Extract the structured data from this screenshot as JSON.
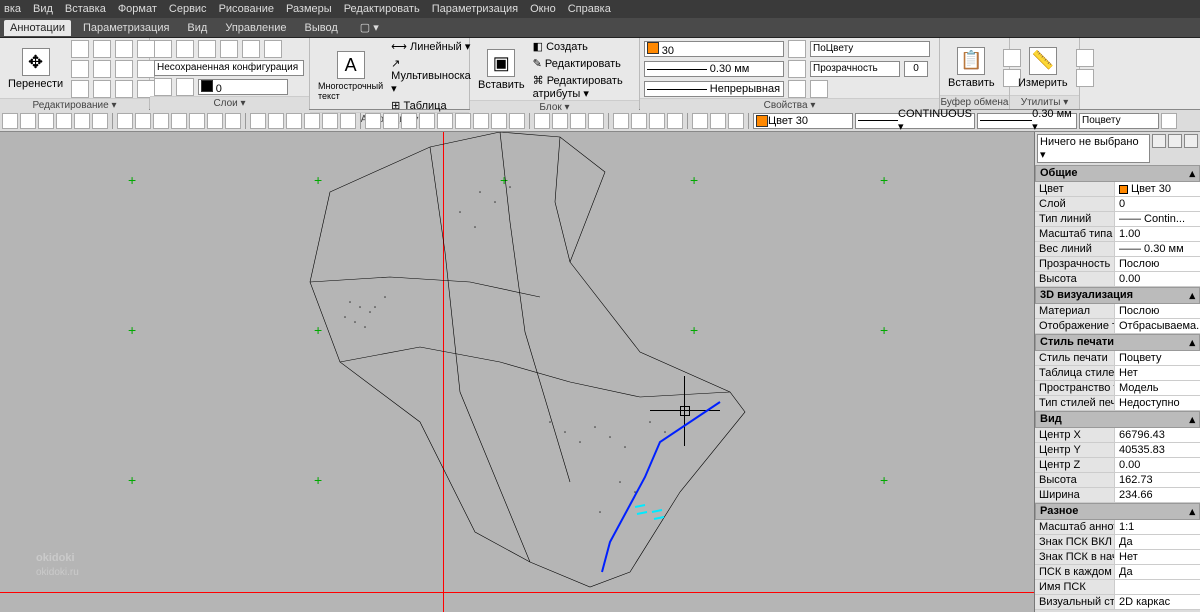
{
  "menu": [
    "вка",
    "Вид",
    "Вставка",
    "Формат",
    "Сервис",
    "Рисование",
    "Размеры",
    "Редактировать",
    "Параметризация",
    "Окно",
    "Справка"
  ],
  "tabs": {
    "items": [
      "Аннотации",
      "Параметризация",
      "Вид",
      "Управление",
      "Вывод"
    ],
    "active": 0
  },
  "ribbon": {
    "edit": {
      "label": "Редактирование ▾",
      "move": "Перенести",
      "config": "Несохраненная конфигурация сл",
      "configDrop": "▾"
    },
    "layers": {
      "label": "Слои ▾",
      "swatch": "#000",
      "current": "0"
    },
    "annotation": {
      "label": "Аннотации ▾",
      "mtext": "Многострочный текст",
      "linear": "Линейный ▾",
      "mleader": "Мультивыноска ▾",
      "table": "Таблица"
    },
    "block": {
      "label": "Блок ▾",
      "insert": "Вставить",
      "create": "Создать",
      "edit": "Редактировать",
      "attrs": "Редактировать атрибуты ▾"
    },
    "properties": {
      "label": "Свойства ▾",
      "colorSwatch": "#ff8800",
      "colorName": "30",
      "lineweight": "0.30 мм",
      "linetype": "Непрерывная",
      "bycolor": "ПоЦвету",
      "transparency": "Прозрачность",
      "transVal": "0"
    },
    "clipboard": {
      "label": "Буфер обмена",
      "paste": "Вставить"
    },
    "utils": {
      "label": "Утилиты ▾",
      "measure": "Измерить"
    }
  },
  "toolstrip": {
    "colorSwatch": "#ff8800",
    "colorName": "Цвет 30",
    "linetype": "CONTINUOUS ▾",
    "lineweight": "0.30 мм ▾",
    "plotstyle": "Поцвету"
  },
  "props": {
    "selection": "Ничего не выбрано",
    "sections": [
      {
        "title": "Общие",
        "rows": [
          {
            "k": "Цвет",
            "v": "Цвет 30",
            "sw": true
          },
          {
            "k": "Слой",
            "v": "0"
          },
          {
            "k": "Тип линий",
            "v": "—— Contin..."
          },
          {
            "k": "Масштаб типа л...",
            "v": "1.00"
          },
          {
            "k": "Вес линий",
            "v": "—— 0.30 мм"
          },
          {
            "k": "Прозрачность",
            "v": "Послою"
          },
          {
            "k": "Высота",
            "v": "0.00"
          }
        ]
      },
      {
        "title": "3D визуализация",
        "rows": [
          {
            "k": "Материал",
            "v": "Послою"
          },
          {
            "k": "Отображение те...",
            "v": "Отбрасываема..."
          }
        ]
      },
      {
        "title": "Стиль печати",
        "rows": [
          {
            "k": "Стиль печати",
            "v": "Поцвету"
          },
          {
            "k": "Таблица стилей ...",
            "v": "Нет"
          },
          {
            "k": "Пространство та...",
            "v": "Модель"
          },
          {
            "k": "Тип стилей печати",
            "v": "Недоступно"
          }
        ]
      },
      {
        "title": "Вид",
        "rows": [
          {
            "k": "Центр X",
            "v": "66796.43"
          },
          {
            "k": "Центр Y",
            "v": "40535.83"
          },
          {
            "k": "Центр Z",
            "v": "0.00"
          },
          {
            "k": "Высота",
            "v": "162.73"
          },
          {
            "k": "Ширина",
            "v": "234.66"
          }
        ]
      },
      {
        "title": "Разное",
        "rows": [
          {
            "k": "Масштаб аннота...",
            "v": "1:1"
          },
          {
            "k": "Знак ПСК ВКЛ",
            "v": "Да"
          },
          {
            "k": "Знак ПСК в нач. ...",
            "v": "Нет"
          },
          {
            "k": "ПСК в каждом В...",
            "v": "Да"
          },
          {
            "k": "Имя ПСК",
            "v": ""
          },
          {
            "k": "Визуальный стиль",
            "v": "2D каркас"
          }
        ]
      }
    ]
  },
  "watermark": {
    "brand": "okidoki",
    "sub": "okidoki.ru"
  }
}
